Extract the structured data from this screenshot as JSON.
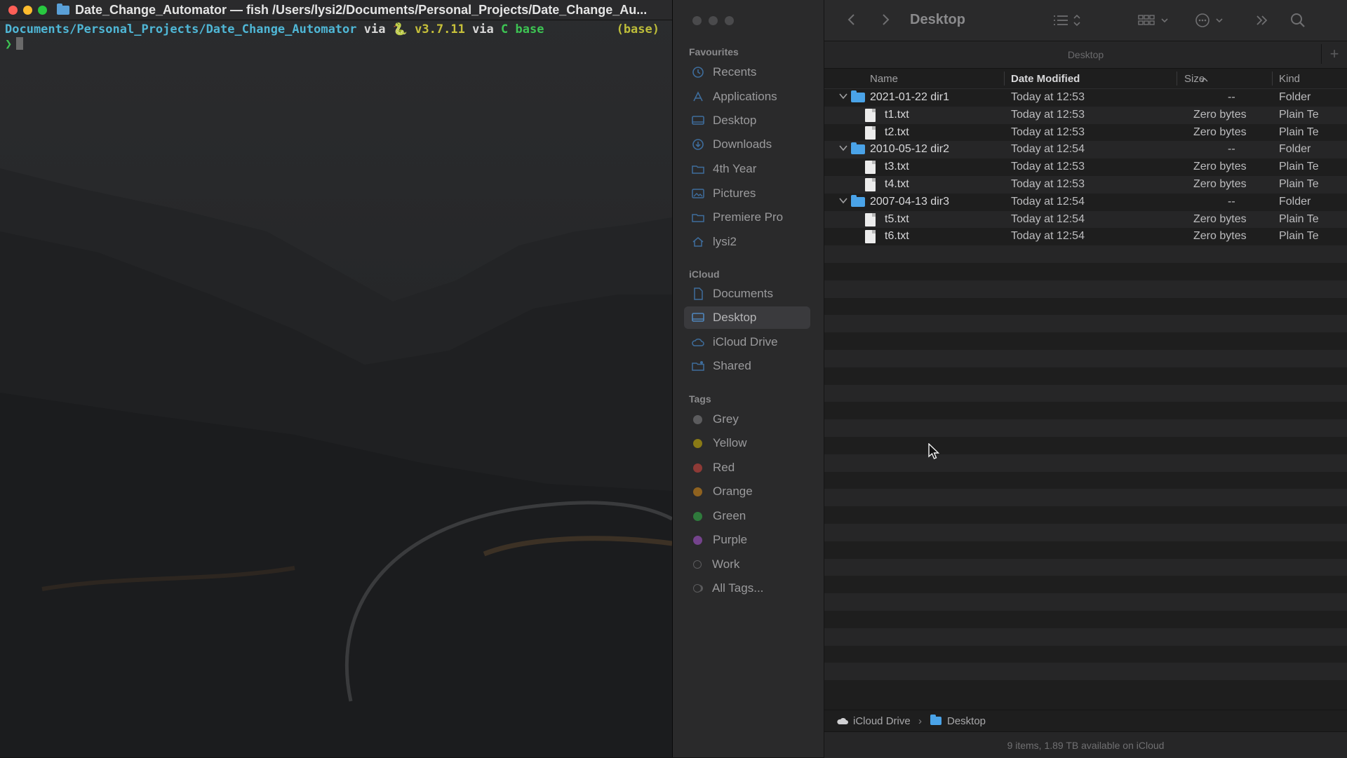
{
  "terminal": {
    "title": "Date_Change_Automator — fish /Users/lysi2/Documents/Personal_Projects/Date_Change_Au...",
    "prompt": {
      "path": "Documents/Personal_Projects/Date_Change_Automator",
      "via1": "via",
      "python_icon": "🐍",
      "python_version": "v3.7.11",
      "via2": "via",
      "conda_env": "C base",
      "right_env": "(base)",
      "arrow": "❯"
    }
  },
  "finder": {
    "sidebar": {
      "favourites_label": "Favourites",
      "favourites": [
        {
          "label": "Recents",
          "icon": "clock-icon"
        },
        {
          "label": "Applications",
          "icon": "applications-icon"
        },
        {
          "label": "Desktop",
          "icon": "desktop-icon"
        },
        {
          "label": "Downloads",
          "icon": "download-icon"
        },
        {
          "label": "4th Year",
          "icon": "folder-icon"
        },
        {
          "label": "Pictures",
          "icon": "pictures-icon"
        },
        {
          "label": "Premiere Pro",
          "icon": "folder-icon"
        },
        {
          "label": "lysi2",
          "icon": "home-icon"
        }
      ],
      "icloud_label": "iCloud",
      "icloud": [
        {
          "label": "Documents",
          "icon": "document-icon"
        },
        {
          "label": "Desktop",
          "icon": "desktop-icon",
          "selected": true
        },
        {
          "label": "iCloud Drive",
          "icon": "cloud-icon"
        },
        {
          "label": "Shared",
          "icon": "shared-folder-icon"
        }
      ],
      "tags_label": "Tags",
      "tags": [
        {
          "label": "Grey",
          "color": "#8e8e93"
        },
        {
          "label": "Yellow",
          "color": "#f5c400"
        },
        {
          "label": "Red",
          "color": "#ff453a"
        },
        {
          "label": "Orange",
          "color": "#ff9f0a"
        },
        {
          "label": "Green",
          "color": "#30d158"
        },
        {
          "label": "Purple",
          "color": "#bf5af2"
        },
        {
          "label": "Work",
          "color": "hollow"
        },
        {
          "label": "All Tags...",
          "color": "all"
        }
      ]
    },
    "toolbar": {
      "title": "Desktop",
      "back": "‹",
      "forward": "›"
    },
    "path_tab": {
      "label": "Desktop",
      "plus": "+"
    },
    "columns": {
      "name": "Name",
      "date": "Date Modified",
      "size": "Size",
      "kind": "Kind",
      "sort_indicator": "^"
    },
    "rows": [
      {
        "type": "folder",
        "name": "2021-01-22 dir1",
        "date": "Today at 12:53",
        "size": "--",
        "kind": "Folder"
      },
      {
        "type": "file",
        "name": "t1.txt",
        "date": "Today at 12:53",
        "size": "Zero bytes",
        "kind": "Plain Te"
      },
      {
        "type": "file",
        "name": "t2.txt",
        "date": "Today at 12:53",
        "size": "Zero bytes",
        "kind": "Plain Te"
      },
      {
        "type": "folder",
        "name": "2010-05-12 dir2",
        "date": "Today at 12:54",
        "size": "--",
        "kind": "Folder"
      },
      {
        "type": "file",
        "name": "t3.txt",
        "date": "Today at 12:53",
        "size": "Zero bytes",
        "kind": "Plain Te"
      },
      {
        "type": "file",
        "name": "t4.txt",
        "date": "Today at 12:53",
        "size": "Zero bytes",
        "kind": "Plain Te"
      },
      {
        "type": "folder",
        "name": "2007-04-13 dir3",
        "date": "Today at 12:54",
        "size": "--",
        "kind": "Folder"
      },
      {
        "type": "file",
        "name": "t5.txt",
        "date": "Today at 12:54",
        "size": "Zero bytes",
        "kind": "Plain Te"
      },
      {
        "type": "file",
        "name": "t6.txt",
        "date": "Today at 12:54",
        "size": "Zero bytes",
        "kind": "Plain Te"
      }
    ],
    "bottom_path": {
      "root": "iCloud Drive",
      "separator": "›",
      "current": "Desktop"
    },
    "status": "9 items, 1.89 TB available on iCloud"
  }
}
